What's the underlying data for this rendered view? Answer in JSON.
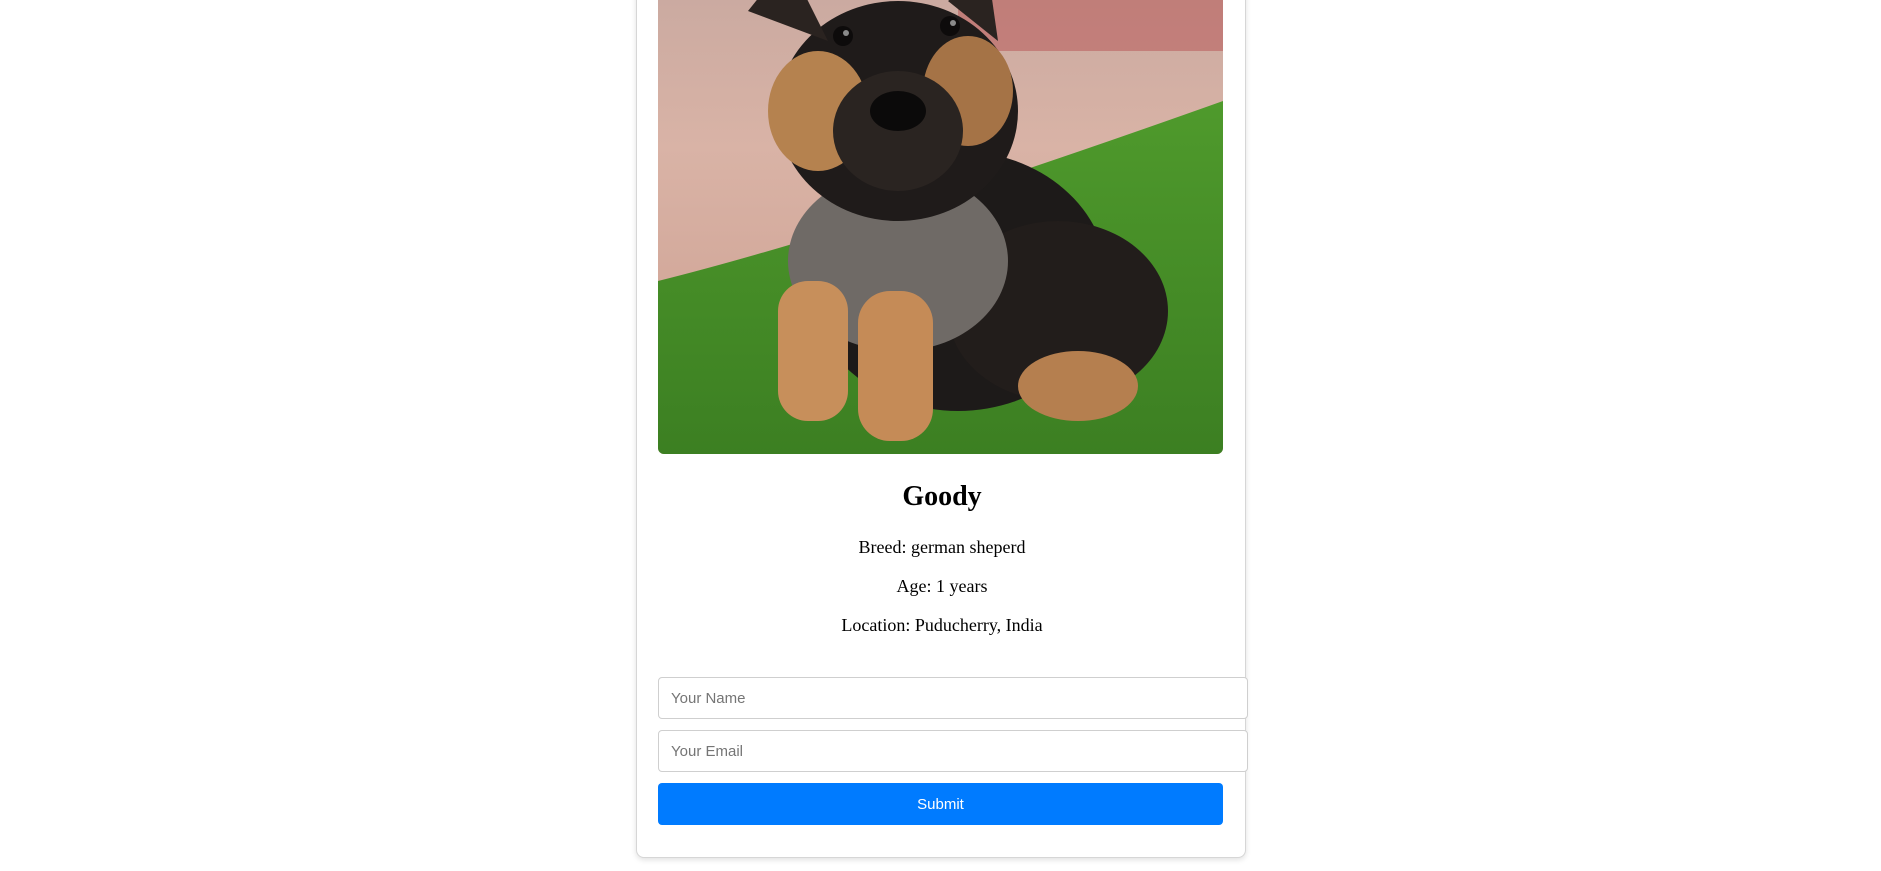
{
  "pet": {
    "name": "Goody",
    "breed_line": "Breed: german sheperd",
    "age_line": "Age: 1 years",
    "location_line": "Location: Puducherry, India",
    "image_subject": "german-shepherd-puppy"
  },
  "form": {
    "name_placeholder": "Your Name",
    "email_placeholder": "Your Email",
    "submit_label": "Submit"
  },
  "colors": {
    "button": "#007bff",
    "button_text": "#ffffff",
    "card_border": "#d6d6d6"
  }
}
